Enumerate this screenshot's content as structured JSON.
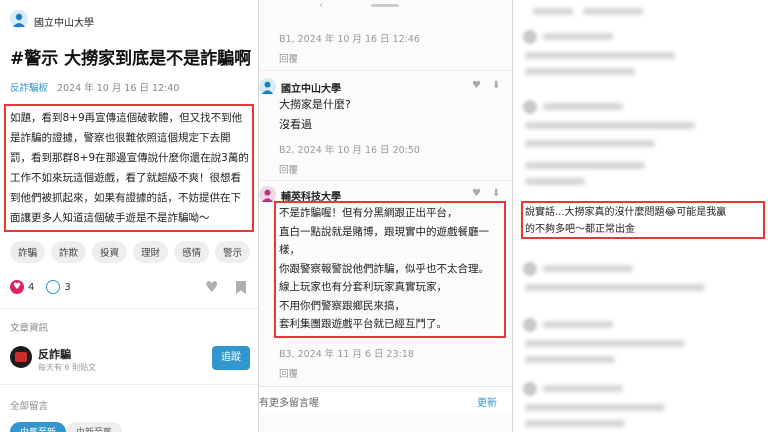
{
  "post": {
    "author_school": "國立中山大學",
    "title": "#警示 大撈家到底是不是詐騙啊",
    "board": "反詐騙板",
    "date": "2024 年 10 月 16 日 12:40",
    "body_lines": [
      "如題，看到8+9再宣傳這個破軟體，但又找不到他",
      "是詐騙的證據，警察也很難依照這個規定下去開",
      "罰，看到那群8+9在那邊宣傳說什麼你還在說3萬的",
      "工作不如來玩這個遊戲，看了就超級不爽！很想看",
      "到他們被抓起來，如果有證據的話，不妨提供在下",
      "面讓更多人知道這個破手遊是不是詐騙呦～"
    ],
    "tags": [
      "詐騙",
      "詐欺",
      "投資",
      "理財",
      "感情",
      "警示"
    ],
    "likes": "4",
    "comments": "3"
  },
  "article_info": {
    "label": "文章資訊",
    "board_name": "反詐騙",
    "board_stats": "每天有 6 則貼文",
    "follow_label": "追蹤"
  },
  "comments_section": {
    "label": "全部留言",
    "sort_hot": "由舊至新",
    "sort_new": "由新至舊"
  },
  "thread": {
    "b1_meta": "B1, 2024 年 10 月 16 日 12:46",
    "b1_reply": "回覆",
    "b2_school": "國立中山大學",
    "b2_lines": [
      "大撈家是什麼?",
      "沒看過"
    ],
    "b2_meta": "B2, 2024 年 10 月 16 日 20:50",
    "b2_reply": "回覆",
    "b3_school": "輔英科技大學",
    "b3_lines": [
      "不是詐騙喔！但有分黑網跟正出平台，",
      "直白一點說就是賭博，跟現實中的遊戲餐廳一",
      "樣，",
      "你跟警察報警說他們詐騙，似乎也不太合理。",
      "線上玩家也有分套利玩家真實玩家，",
      "不用你們警察跟鄉民來搞，",
      "套利集團跟遊戲平台就已經互鬥了。"
    ],
    "b3_meta": "B3, 2024 年 11 月 6 日 23:18",
    "b3_reply": "回覆",
    "footer_left": "有更多留言喔",
    "footer_right": "更新"
  },
  "panel3": {
    "comment_lines": [
      "說實話...大撈家真的沒什麼問題😂可能是我贏",
      "的不夠多吧～都正常出金"
    ]
  },
  "colors": {
    "accent": "#3397cf",
    "highlight_border": "#e53935",
    "like": "#e0245e"
  }
}
